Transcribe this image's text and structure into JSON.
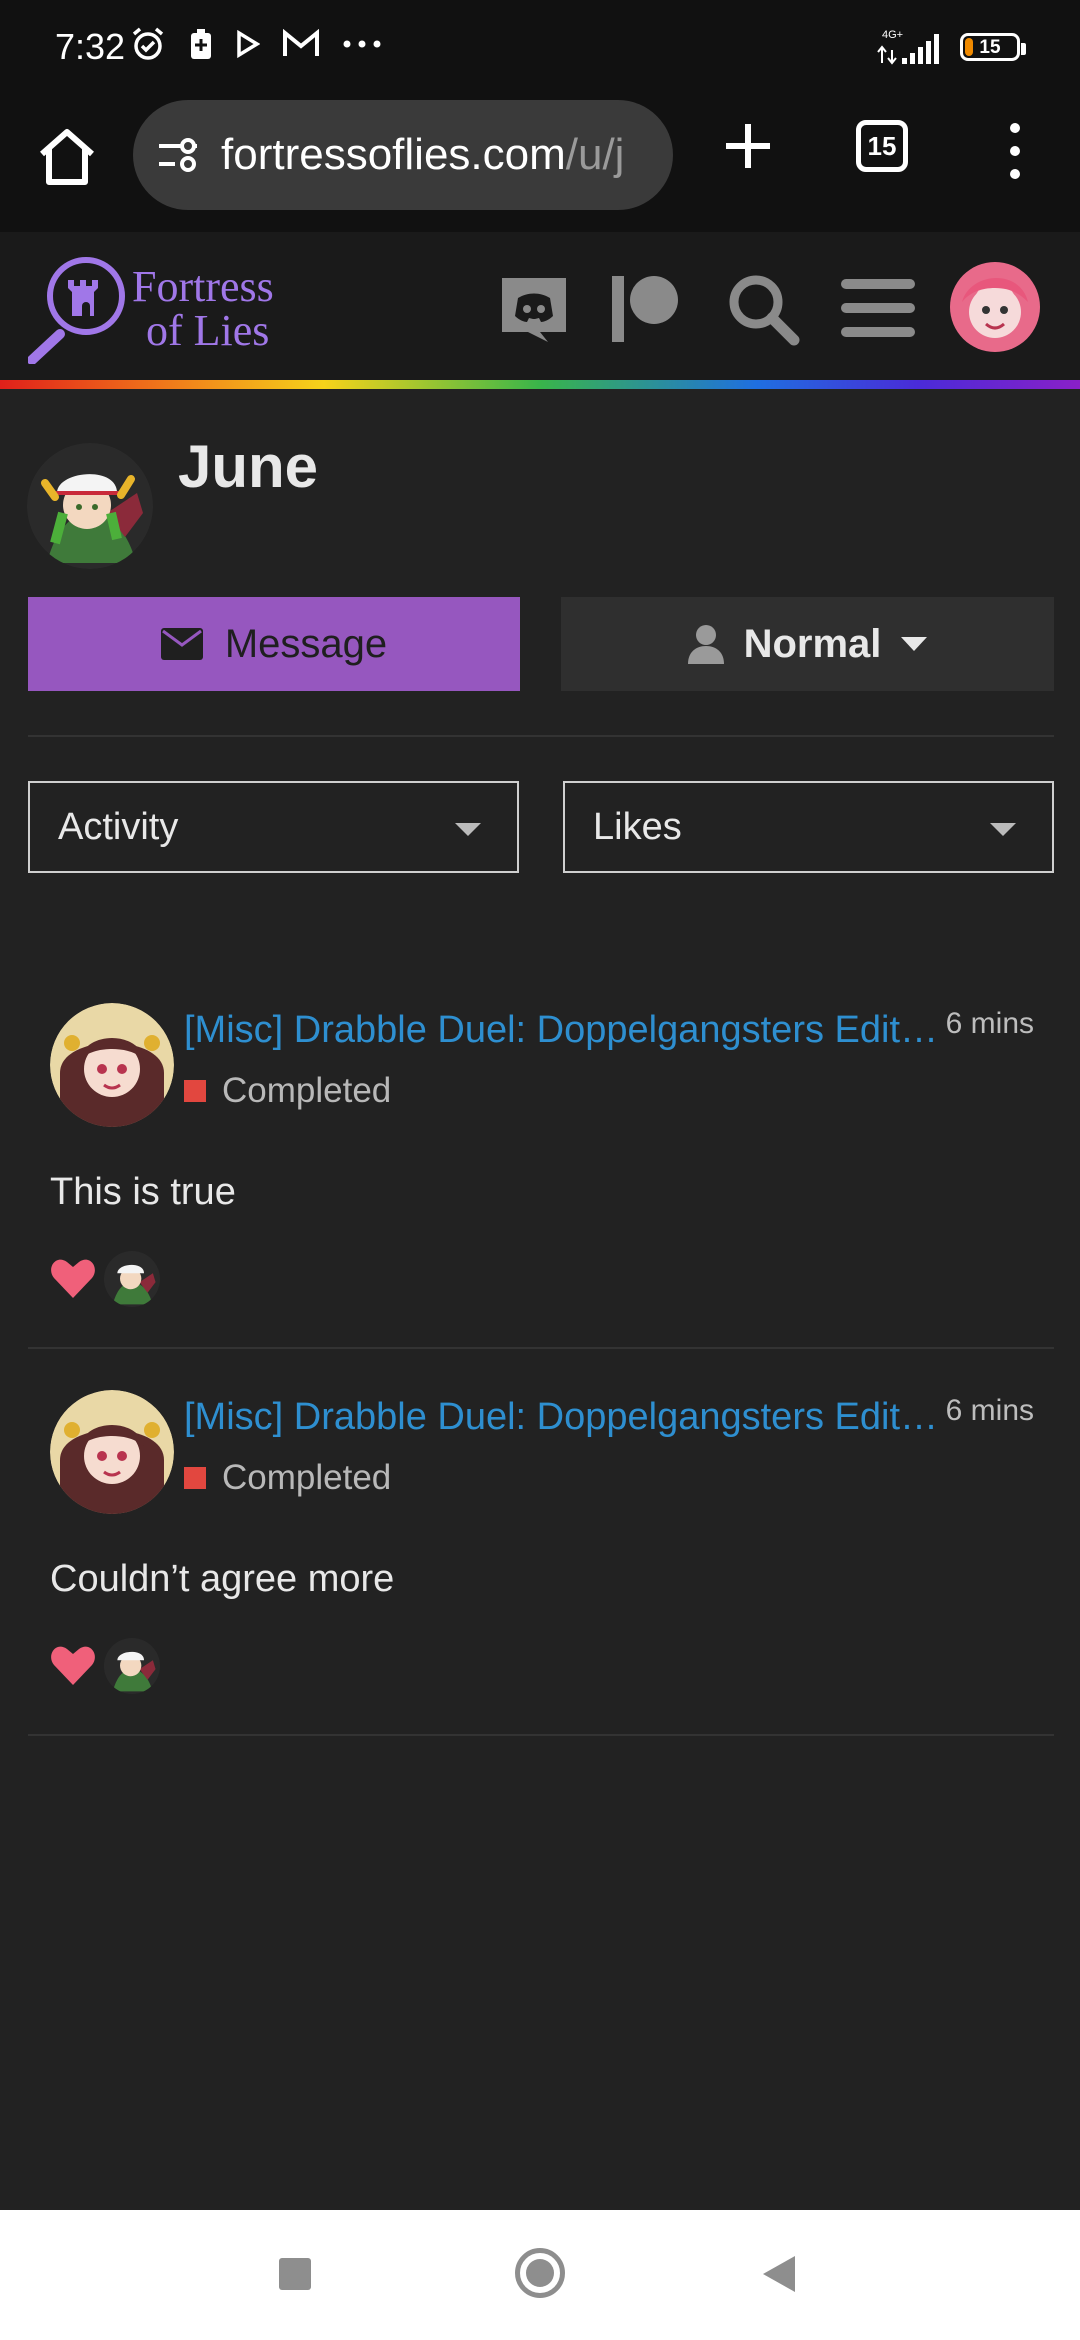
{
  "status_bar": {
    "time": "7:32",
    "network": "4G+",
    "battery": "15",
    "battery_level": 0.15
  },
  "browser": {
    "url_host": "fortressoflies.com",
    "url_path": "/u/j",
    "tab_count": "15"
  },
  "site": {
    "logo_line1": "Fortress",
    "logo_line2": "of Lies",
    "accent": "#a077e8"
  },
  "profile": {
    "username": "June",
    "message_label": "Message",
    "notification_label": "Normal"
  },
  "filters": {
    "activity": "Activity",
    "likes": "Likes"
  },
  "posts": [
    {
      "title": "[Misc] Drabble Duel: Doppelgangsters Edition",
      "time": "6 mins",
      "status": "Completed",
      "body": "This is true"
    },
    {
      "title": "[Misc] Drabble Duel: Doppelgangsters Edition",
      "time": "6 mins",
      "status": "Completed",
      "body": "Couldn’t agree more"
    }
  ],
  "colors": {
    "message_button": "#9657bf",
    "link": "#2e8fd0",
    "status_completed": "#e2473f",
    "heart": "#f0607a"
  }
}
